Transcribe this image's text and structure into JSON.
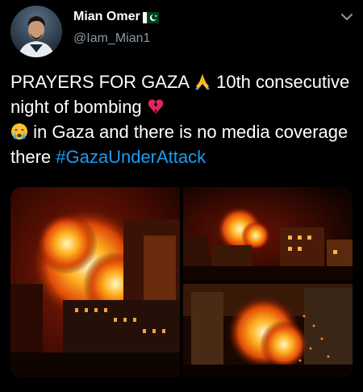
{
  "user": {
    "name": "Mian Omer",
    "handle": "@Iam_Mian1",
    "flag_icon": "pakistan-flag-icon"
  },
  "tweet": {
    "text_parts": [
      "PRAYERS FOR GAZA ",
      " 10th consecutive night of bombing ",
      " in Gaza and there is no media coverage there "
    ],
    "hashtag": "#GazaUnderAttack",
    "emojis": [
      "praying-hands-icon",
      "broken-heart-icon",
      "crying-face-icon"
    ]
  },
  "media": {
    "images": [
      "explosion-photo-left",
      "explosion-photo-top-right",
      "explosion-photo-bottom-right"
    ]
  },
  "colors": {
    "background": "#000000",
    "text": "#ffffff",
    "secondary": "#8b98a5",
    "link": "#1d9bf0"
  }
}
